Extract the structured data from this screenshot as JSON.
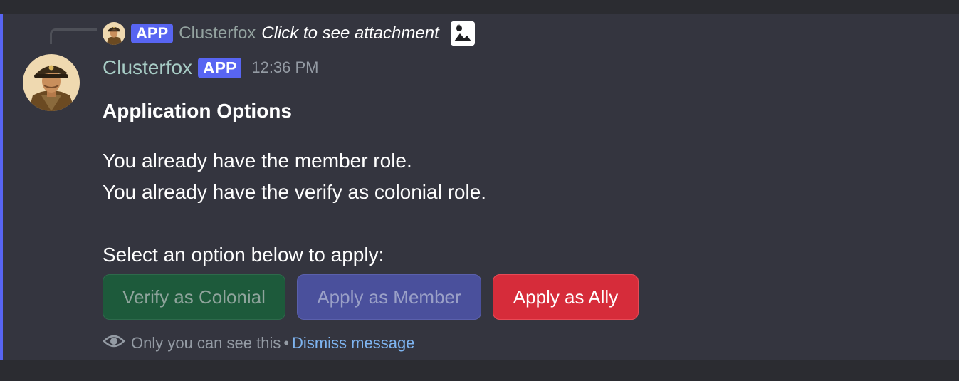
{
  "colors": {
    "accent": "#5865f2",
    "username": "#a7ccc5",
    "link": "#7eb4f0",
    "button_success": "#1d5a3b",
    "button_primary": "#4a509c",
    "button_danger": "#d62c3a"
  },
  "reply": {
    "badge": "APP",
    "username": "Clusterfox",
    "content": "Click to see attachment",
    "attachment_icon": "image-icon"
  },
  "message": {
    "username": "Clusterfox",
    "badge": "APP",
    "timestamp": "12:36 PM",
    "title": "Application Options",
    "lines": [
      "You already have the member role.",
      "You already have the verify as colonial role.",
      "Select an option below to apply:"
    ]
  },
  "buttons": [
    {
      "label": "Verify as Colonial",
      "style": "success",
      "disabled": true
    },
    {
      "label": "Apply as Member",
      "style": "primary",
      "disabled": true
    },
    {
      "label": "Apply as Ally",
      "style": "danger",
      "disabled": false
    }
  ],
  "footer": {
    "icon": "eye-icon",
    "notice": "Only you can see this",
    "separator": "•",
    "dismiss": "Dismiss message"
  }
}
